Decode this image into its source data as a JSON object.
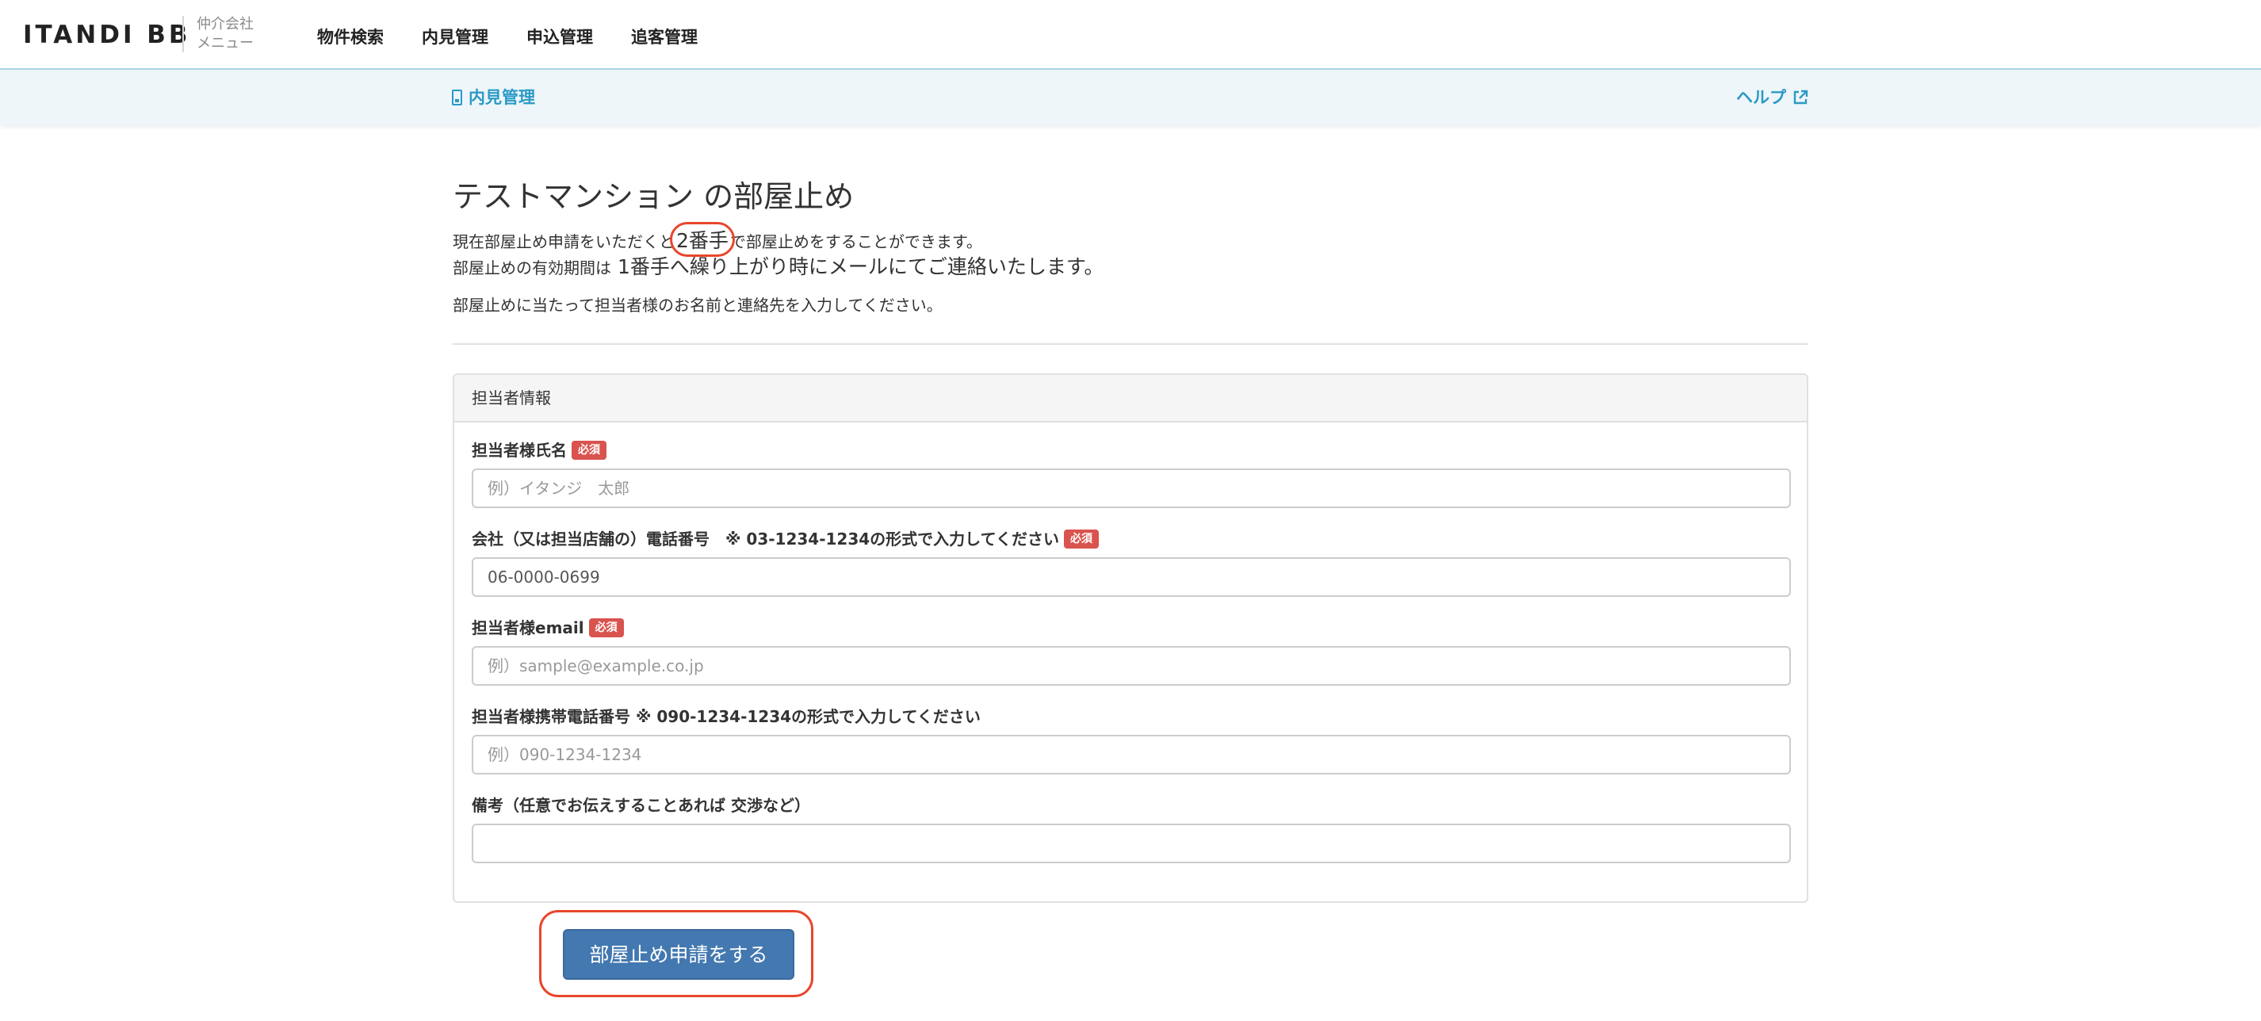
{
  "app": {
    "logo": "ITANDI BB",
    "logo_sub_line1": "仲介会社",
    "logo_sub_line2": "メニュー"
  },
  "nav": {
    "items": [
      {
        "label": "物件検索"
      },
      {
        "label": "内見管理"
      },
      {
        "label": "申込管理"
      },
      {
        "label": "追客管理"
      }
    ]
  },
  "subheader": {
    "breadcrumb": "内見管理",
    "help": "ヘルプ"
  },
  "page": {
    "title": "テストマンション の部屋止め",
    "intro_line1_before": "現在部屋止め申請をいただくと",
    "intro_line1_highlight": "2番手",
    "intro_line1_after": "で部屋止めをすることができます。",
    "intro_line2_before": "部屋止めの有効期間は",
    "intro_line2_big": " 1番手へ繰り上がり時にメールにてご連絡いたします。",
    "intro_line3": "部屋止めに当たって担当者様のお名前と連絡先を入力してください。"
  },
  "panel": {
    "heading": "担当者情報",
    "required_badge": "必須",
    "fields": {
      "name": {
        "label": "担当者様氏名",
        "placeholder": "例）イタンジ　太郎",
        "value": ""
      },
      "company_phone": {
        "label": "会社（又は担当店舗の）電話番号　※ 03-1234-1234の形式で入力してください",
        "placeholder": "",
        "value": "06-0000-0699"
      },
      "email": {
        "label": "担当者様email",
        "placeholder": "例）sample@example.co.jp",
        "value": ""
      },
      "mobile": {
        "label": "担当者様携帯電話番号 ※ 090-1234-1234の形式で入力してください",
        "placeholder": "例）090-1234-1234",
        "value": ""
      },
      "notes": {
        "label": "備考（任意でお伝えすることあれば 交渉など）",
        "placeholder": "",
        "value": ""
      }
    }
  },
  "submit": {
    "label": "部屋止め申請をする"
  },
  "colors": {
    "accent": "#2a9ac6",
    "button": "#4378b0",
    "required": "#d9534f",
    "annotation": "#e8462c"
  }
}
